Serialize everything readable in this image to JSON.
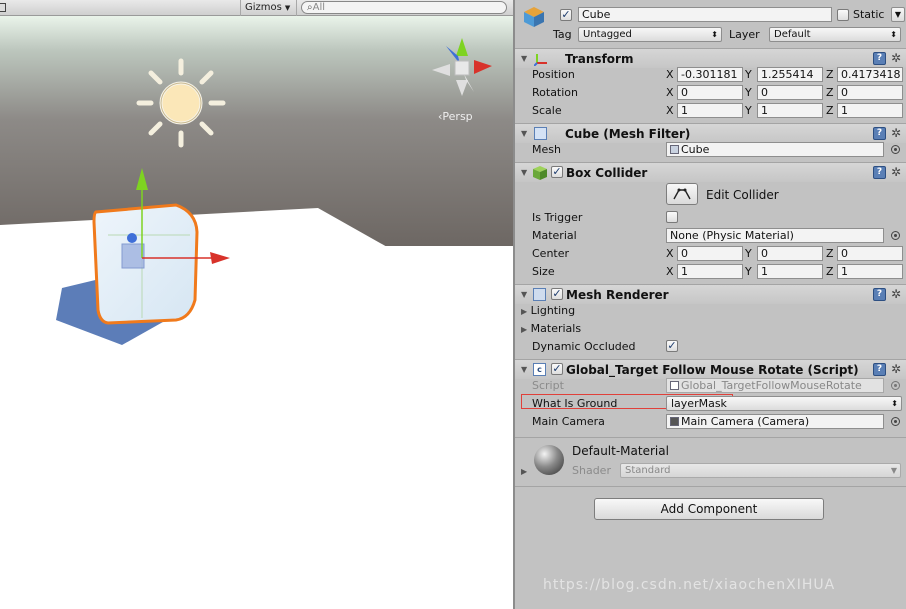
{
  "scene": {
    "gizmos_label": "Gizmos",
    "search_placeholder": "All",
    "persp_label": "Persp"
  },
  "header": {
    "object_active": true,
    "object_name": "Cube",
    "static_label": "Static",
    "static_checked": false,
    "tag_label": "Tag",
    "tag_value": "Untagged",
    "layer_label": "Layer",
    "layer_value": "Default"
  },
  "transform": {
    "title": "Transform",
    "position_label": "Position",
    "rotation_label": "Rotation",
    "scale_label": "Scale",
    "axis_x": "X",
    "axis_y": "Y",
    "axis_z": "Z",
    "position": {
      "x": "-0.301181",
      "y": "1.255414",
      "z": "0.4173418"
    },
    "rotation": {
      "x": "0",
      "y": "0",
      "z": "0"
    },
    "scale": {
      "x": "1",
      "y": "1",
      "z": "1"
    }
  },
  "mesh_filter": {
    "title": "Cube (Mesh Filter)",
    "mesh_label": "Mesh",
    "mesh_value": "Cube"
  },
  "box_collider": {
    "title": "Box Collider",
    "enabled": true,
    "edit_label": "Edit Collider",
    "is_trigger_label": "Is Trigger",
    "is_trigger_checked": false,
    "material_label": "Material",
    "material_value": "None (Physic Material)",
    "center_label": "Center",
    "size_label": "Size",
    "center": {
      "x": "0",
      "y": "0",
      "z": "0"
    },
    "size": {
      "x": "1",
      "y": "1",
      "z": "1"
    }
  },
  "mesh_renderer": {
    "title": "Mesh Renderer",
    "enabled": true,
    "lighting_label": "Lighting",
    "materials_label": "Materials",
    "dynamic_occluded_label": "Dynamic Occluded",
    "dynamic_occluded_checked": true
  },
  "script": {
    "title": "Global_Target Follow Mouse Rotate (Script)",
    "enabled": true,
    "script_label": "Script",
    "script_value": "Global_TargetFollowMouseRotate",
    "what_is_ground_label": "What Is Ground",
    "what_is_ground_value": "layerMask",
    "main_camera_label": "Main Camera",
    "main_camera_value": "Main Camera (Camera)"
  },
  "material": {
    "name": "Default-Material",
    "shader_label": "Shader",
    "shader_value": "Standard"
  },
  "add_component_label": "Add Component",
  "watermark_text": "https://blog.csdn.net/xiaochenXIHUA",
  "colors": {
    "inspector_bg": "#c2c2c2",
    "selection_outline": "#f07a1c",
    "highlight_box": "#e0403a",
    "axis_x": "#d8322a",
    "axis_y": "#7ed321",
    "axis_z": "#3f6fd8"
  }
}
